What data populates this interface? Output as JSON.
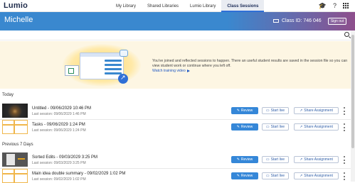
{
  "app": {
    "logo": "Lumio"
  },
  "nav": {
    "tabs": [
      {
        "label": "My Library",
        "active": false
      },
      {
        "label": "Shared Libraries",
        "active": false
      },
      {
        "label": "Lumio Library",
        "active": false
      },
      {
        "label": "Class Sessions",
        "active": true
      }
    ]
  },
  "top_icons": [
    "graduation-cap-icon",
    "help-icon",
    "apps-grid-icon"
  ],
  "header": {
    "user_name": "Michelle",
    "class_id": "Class ID: 746 046",
    "signout_label": "Sign out",
    "colors": {
      "left": "#3a88cf",
      "right": "#8e4f8c"
    }
  },
  "banner": {
    "text": "You've joined and reflected sessions to happen. There an useful student results are saved in the session file so you can view student work or continue where you left off.",
    "link_label": "Watch training video"
  },
  "sections": [
    {
      "heading": "Today",
      "rows": [
        {
          "title": "Untitled - 09/06/2029 10:46 PM",
          "subtitle": "Last session: 09/06/2029 1:46 PM",
          "thumb": "dark"
        },
        {
          "title": "Tasks - 09/06/2029 1:24 PM",
          "subtitle": "Last session: 09/06/2029 1:24 PM",
          "thumb": "template"
        }
      ]
    },
    {
      "heading": "Previous 7 Days",
      "rows": [
        {
          "title": "Sorted Edits - 09/03/2029 3:25 PM",
          "subtitle": "Last session: 09/03/2029 3:25 PM",
          "thumb": "slide"
        },
        {
          "title": "Main idea double summary - 09/02/2029 1:02 PM",
          "subtitle": "Last session: 09/02/2029 1:02 PM",
          "thumb": "template"
        }
      ]
    }
  ],
  "row_actions": {
    "review": "Review",
    "start_live": "Start live",
    "share_assignment": "Share Assignment"
  },
  "colors": {
    "accent": "#3587d8",
    "banner_bg": "#fdf6e3",
    "template_outline": "#f0b64a"
  }
}
